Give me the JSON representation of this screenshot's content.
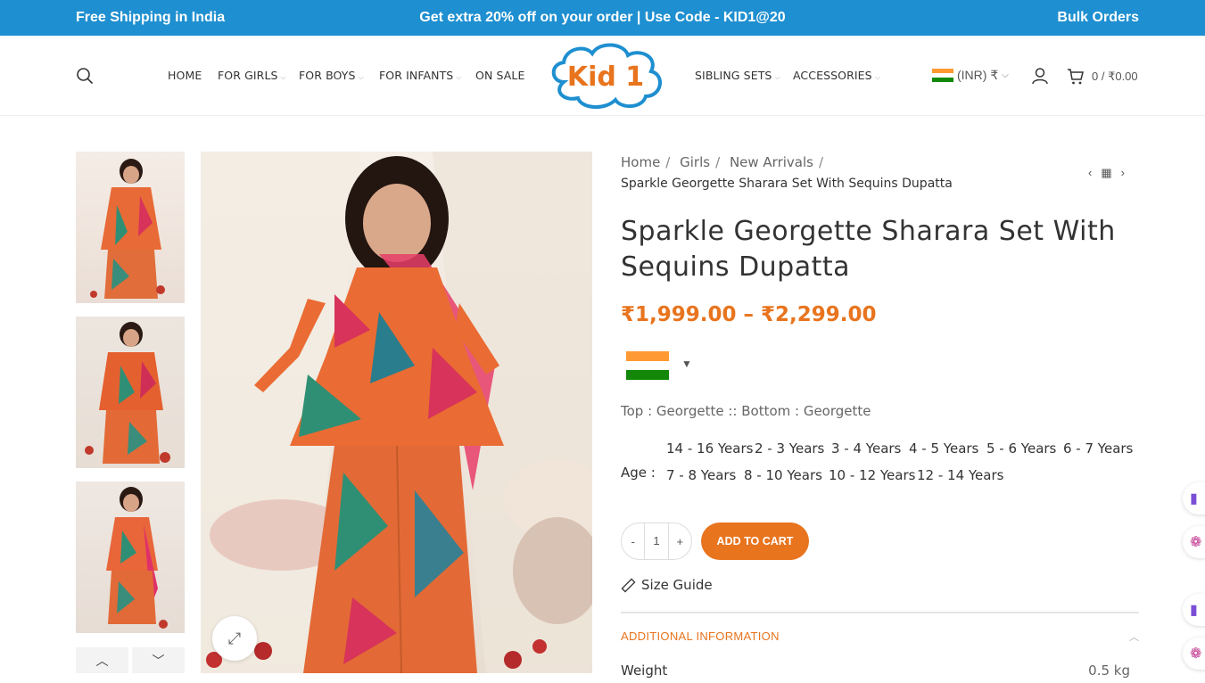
{
  "topbar": {
    "left": "Free Shipping in India",
    "center": "Get extra 20% off on your order | Use Code - KID1@20",
    "right": "Bulk Orders"
  },
  "nav": {
    "home": "HOME",
    "girls": "FOR GIRLS",
    "boys": "FOR BOYS",
    "infants": "FOR INFANTS",
    "sale": "ON SALE",
    "sibling": "SIBLING SETS",
    "accessories": "ACCESSORIES"
  },
  "logo": {
    "text": "Kid 1"
  },
  "currency": {
    "label": "(INR) ₹"
  },
  "cart": {
    "summary": "0 / ₹0.00"
  },
  "breadcrumb": {
    "items": [
      "Home",
      "Girls",
      "New Arrivals"
    ],
    "current": "Sparkle Georgette Sharara Set With Sequins Dupatta"
  },
  "product": {
    "title": "Sparkle Georgette Sharara Set With Sequins Dupatta",
    "price": "₹1,999.00 – ₹2,299.00",
    "material": "Top : Georgette :: Bottom : Georgette",
    "age_label": "Age :",
    "ages": [
      "14 - 16 Years",
      "2 - 3 Years",
      "3 - 4 Years",
      "4 - 5 Years",
      "5 - 6 Years",
      "6 - 7 Years",
      "7 - 8 Years",
      "8 - 10 Years",
      "10 - 12 Years",
      "12 - 14 Years"
    ],
    "qty": {
      "minus": "-",
      "value": "1",
      "plus": "+"
    },
    "add_to_cart": "ADD TO CART",
    "size_guide": "Size Guide",
    "additional_info": "ADDITIONAL INFORMATION",
    "weight_label": "Weight",
    "weight_value": "0.5 kg"
  },
  "colors": {
    "topbar": "#1e8fd0",
    "accent": "#e8741e"
  }
}
